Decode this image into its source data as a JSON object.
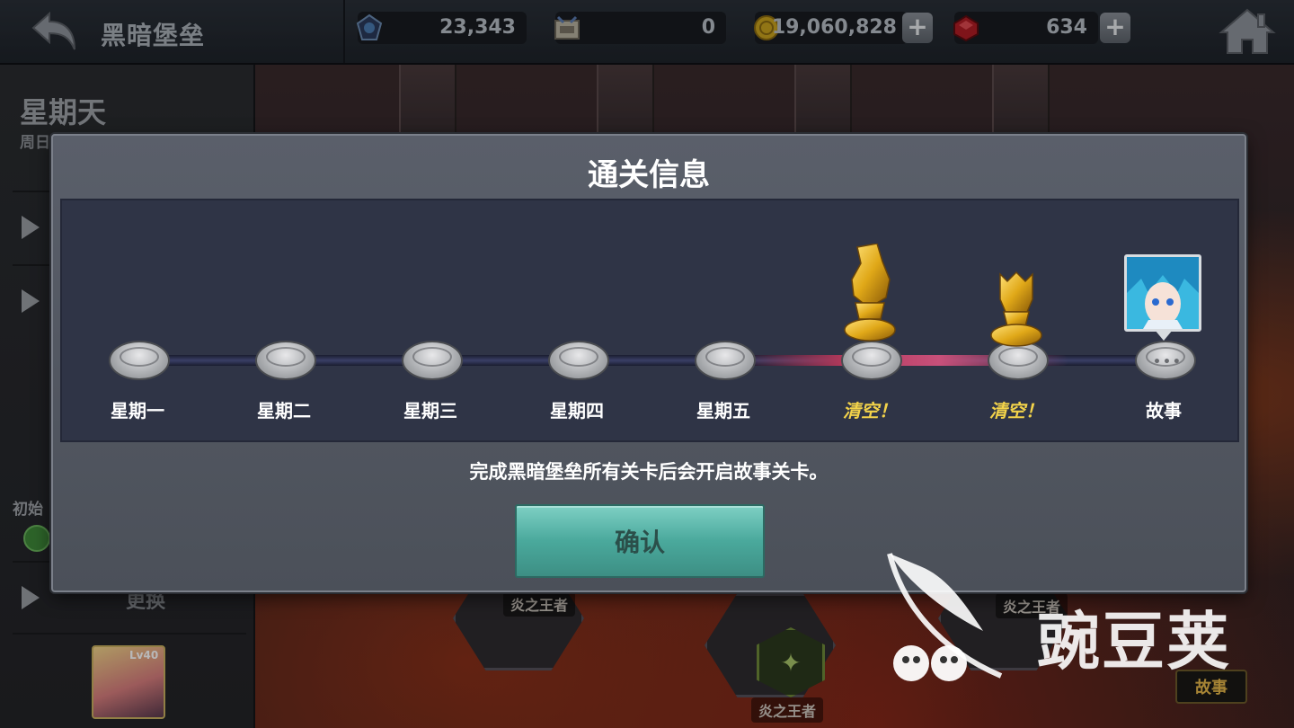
{
  "topbar": {
    "title": "黑暗堡垒",
    "resources": [
      {
        "icon": "crystal-icon",
        "value": "23,343"
      },
      {
        "icon": "ticket-icon",
        "value": "0"
      },
      {
        "icon": "gold-coin-icon",
        "value": "19,060,828"
      },
      {
        "icon": "ruby-icon",
        "value": "634"
      }
    ],
    "plus_label": "+"
  },
  "left_panel": {
    "day": "星期天",
    "day_sub": "周日特",
    "row_label": "初始",
    "change_label": "更换",
    "hero_level": "Lv40"
  },
  "background": {
    "stage_labels": [
      "炎之王者",
      "炎之王者",
      "炎之王者"
    ],
    "story_tag": "故事"
  },
  "modal": {
    "title": "通关信息",
    "nodes": [
      {
        "label": "星期一",
        "state": "locked"
      },
      {
        "label": "星期二",
        "state": "locked"
      },
      {
        "label": "星期三",
        "state": "locked"
      },
      {
        "label": "星期四",
        "state": "locked"
      },
      {
        "label": "星期五",
        "state": "locked"
      },
      {
        "label": "清空！",
        "state": "cleared"
      },
      {
        "label": "清空！",
        "state": "cleared"
      },
      {
        "label": "故事",
        "state": "story"
      }
    ],
    "info": "完成黑暗堡垒所有关卡后会开启故事关卡。",
    "confirm_label": "确认"
  },
  "watermark": {
    "text": "豌豆荚"
  },
  "colors": {
    "clear_label": "#f2d24a",
    "confirm_button": "#4aa99c",
    "modal_bg": "#52575f",
    "track_bg": "#2f3446"
  }
}
